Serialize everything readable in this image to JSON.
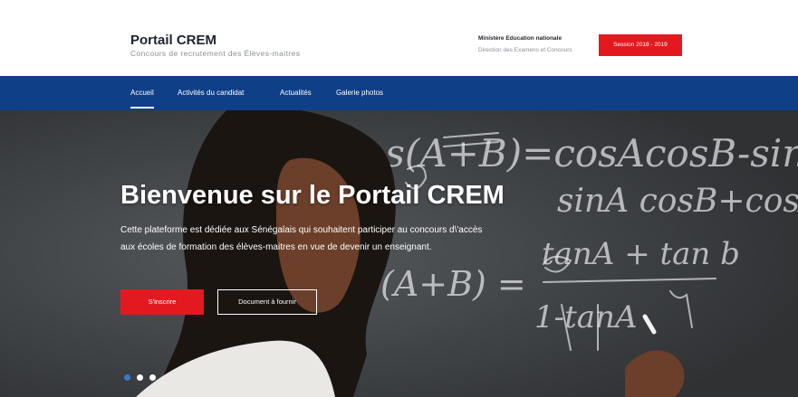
{
  "header": {
    "title": "Portail CREM",
    "subtitle": "Concours de recrutement des Élèves-maitres",
    "ministry": "Ministère Education nationale",
    "direction": "Direction des Examens et Concours",
    "session_button": "Session 2018 - 2019"
  },
  "nav": {
    "items": [
      {
        "label": "Accueil",
        "active": true
      },
      {
        "label": "Activités du candidat",
        "active": false
      },
      {
        "label": "Actualités",
        "active": false
      },
      {
        "label": "Galerie photos",
        "active": false
      }
    ]
  },
  "hero": {
    "title": "Bienvenue sur le Portail CREM",
    "description": "Cette plateforme est dédiée aux Sénégalais qui souhaitent participer au concours d\\'accès aux écoles de formation des élèves-maitres en vue de devenir un enseignant.",
    "buttons": {
      "register": "S'inscrire",
      "documents": "Document à fournir"
    },
    "carousel": {
      "slides": 3,
      "active_index": 0
    },
    "chalkboard_formulas": [
      "Cos(A+B)=cosAcosB-sinA",
      "sinA cosB+cosA",
      "(A+B) =",
      "tanA + tan b",
      "1-tanA"
    ]
  },
  "colors": {
    "brand_red": "#e3191f",
    "nav_blue": "#0f3f86",
    "dot_active": "#3b78c9"
  }
}
